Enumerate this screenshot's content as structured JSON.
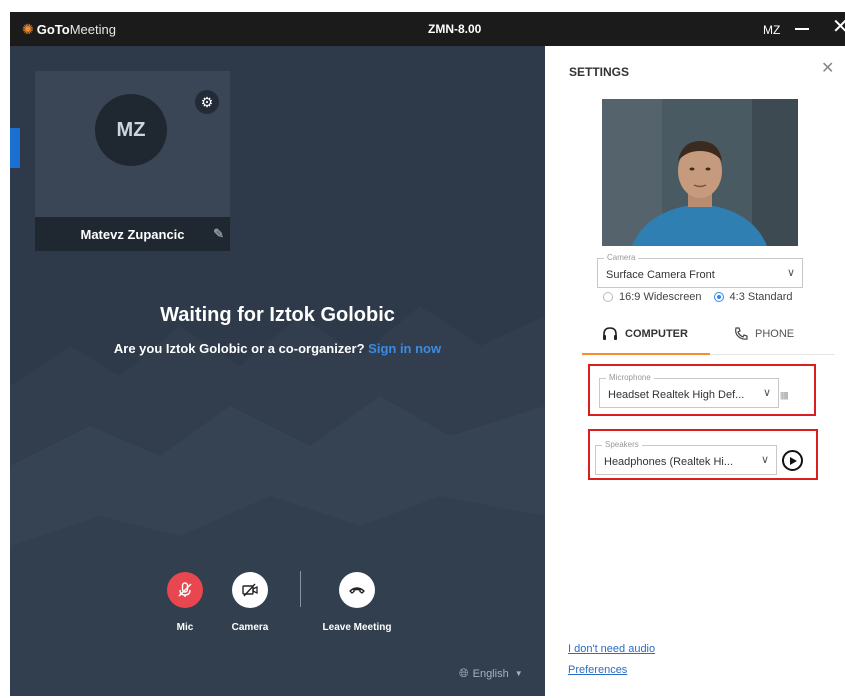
{
  "titlebar": {
    "logo_goto": "GoTo",
    "logo_meeting": "Meeting",
    "window_title": "ZMN-8.00",
    "user_initials": "MZ"
  },
  "participant": {
    "initials": "MZ",
    "name": "Matevz Zupancic"
  },
  "waiting": {
    "heading": "Waiting for Iztok Golobic",
    "question": "Are you Iztok Golobic or a co-organizer?",
    "sign_in": "Sign in now"
  },
  "controls": {
    "mic_label": "Mic",
    "camera_label": "Camera",
    "leave_label": "Leave Meeting"
  },
  "language": {
    "value": "English"
  },
  "settings": {
    "title": "SETTINGS",
    "camera_legend": "Camera",
    "camera_value": "Surface Camera Front",
    "aspect_widescreen": "16:9 Widescreen",
    "aspect_standard": "4:3 Standard",
    "aspect_selected": "4:3 Standard",
    "tab_computer": "COMPUTER",
    "tab_phone": "PHONE",
    "microphone_legend": "Microphone",
    "microphone_value": "Headset Realtek High Def...",
    "speakers_legend": "Speakers",
    "speakers_value": "Headphones (Realtek Hi...",
    "link_no_audio": "I don't need audio",
    "link_preferences": "Preferences"
  },
  "colors": {
    "stage_bg": "#2e3a4a",
    "mic_red": "#e8474f",
    "accent_orange": "#f68d2e",
    "link_blue": "#2b6cc4",
    "highlight_red": "#d81e1e"
  },
  "icons": [
    "gear-icon",
    "pencil-icon",
    "mic-muted-icon",
    "camera-off-icon",
    "hangup-icon",
    "globe-icon",
    "headset-icon",
    "phone-icon",
    "play-icon",
    "close-icon"
  ]
}
